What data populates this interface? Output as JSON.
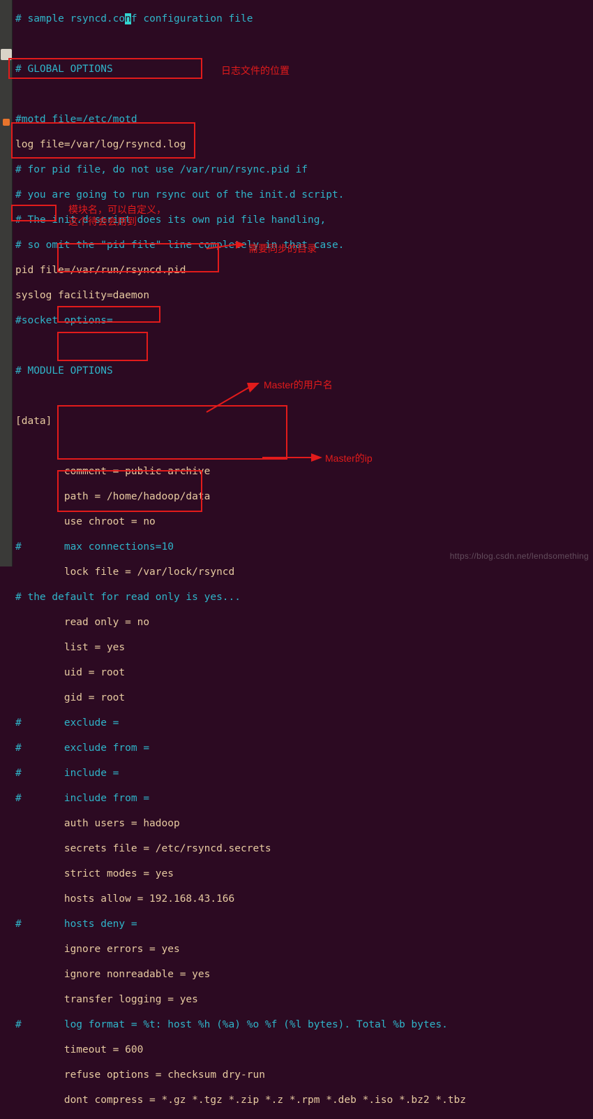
{
  "code": {
    "l1": "# sample rsyncd.conf configuration file",
    "l1_cursor_char": "n",
    "l2": "",
    "l3": "# GLOBAL OPTIONS",
    "l4": "",
    "l5": "#motd file=/etc/motd",
    "l6": "log file=/var/log/rsyncd.log",
    "l7": "# for pid file, do not use /var/run/rsync.pid if",
    "l8": "# you are going to run rsync out of the init.d script.",
    "l9": "# The init.d script does its own pid file handling,",
    "l10": "# so omit the \"pid file\" line completely in that case.",
    "l11": "pid file=/var/run/rsyncd.pid",
    "l12": "syslog facility=daemon",
    "l13": "#socket options=",
    "l14": "",
    "l15": "# MODULE OPTIONS",
    "l16": "",
    "l17": "[data]",
    "l18": "",
    "l19": "        comment = public archive",
    "l20": "        path = /home/hadoop/data",
    "l21": "        use chroot = no",
    "l22": "#       max connections=10",
    "l23": "        lock file = /var/lock/rsyncd",
    "l24": "# the default for read only is yes...",
    "l25": "        read only = no",
    "l26": "        list = yes",
    "l27": "        uid = root",
    "l28": "        gid = root",
    "l29": "#       exclude = ",
    "l30": "#       exclude from = ",
    "l31": "#       include =",
    "l32": "#       include from =",
    "l33": "        auth users = hadoop",
    "l34": "        secrets file = /etc/rsyncd.secrets",
    "l35": "        strict modes = yes",
    "l36": "        hosts allow = 192.168.43.166",
    "l37": "#       hosts deny =",
    "l38": "        ignore errors = yes",
    "l39": "        ignore nonreadable = yes",
    "l40": "        transfer logging = yes",
    "l41": "#       log format = %t: host %h (%a) %o %f (%l bytes). Total %b bytes.",
    "l42": "        timeout = 600",
    "l43": "        refuse options = checksum dry-run",
    "l44": "        dont compress = *.gz *.tgz *.zip *.z *.rpm *.deb *.iso *.bz2 *.tbz"
  },
  "annotations": {
    "a1": "日志文件的位置",
    "a2_l1": "模块名，可以自定义，",
    "a2_l2": "这个待会会用到",
    "a3": "需要同步的目录",
    "a4": "Master的用户名",
    "a5": "Master的ip"
  },
  "watermark": "https://blog.csdn.net/lendsomething"
}
